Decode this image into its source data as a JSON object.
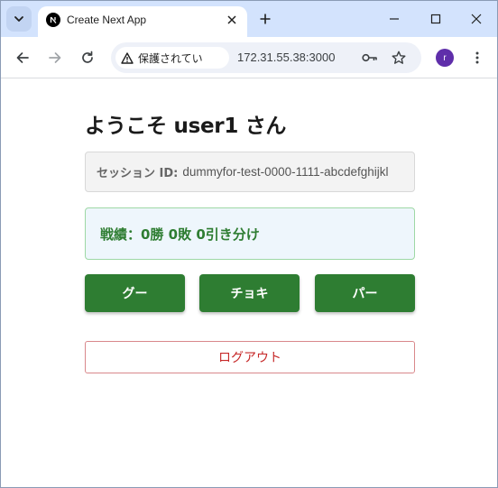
{
  "browser": {
    "tab_title": "Create Next App",
    "security_chip_label": "保護されてい",
    "url": "172.31.55.38:3000",
    "avatar_letter": "r",
    "icons": {
      "tab_search": "chevron-down-icon",
      "favicon": "nextjs-icon",
      "tab_close": "close-icon",
      "new_tab": "plus-icon",
      "minimize": "minimize-icon",
      "maximize": "maximize-icon",
      "window_close": "close-icon",
      "back": "arrow-left-icon",
      "forward": "arrow-right-icon",
      "reload": "reload-icon",
      "warning": "warning-icon",
      "password": "key-icon",
      "bookmark": "star-icon",
      "menu": "more-vert-icon"
    }
  },
  "page": {
    "welcome": "ようこそ user1 さん",
    "session_label": "セッション ID:",
    "session_value": "dummyfor-test-0000-1111-abcdefghijkl",
    "record": "戦績：0勝 0敗 0引き分け",
    "hands": [
      {
        "label": "グー"
      },
      {
        "label": "チョキ"
      },
      {
        "label": "パー"
      }
    ],
    "logout": "ログアウト"
  },
  "colors": {
    "primary_green": "#2e7d32",
    "logout_red": "#c62828",
    "tabstrip_bg": "#d3e3fd",
    "avatar_bg": "#5f2eaa"
  }
}
